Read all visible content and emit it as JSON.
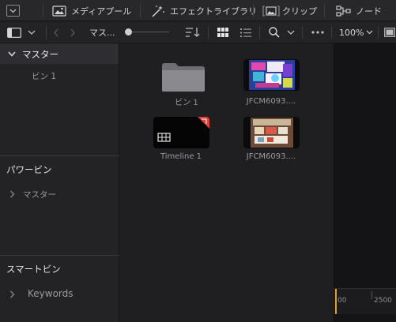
{
  "toolbar": {
    "media_pool": "メディアプール",
    "effects_library": "エフェクトライブラリ",
    "clips": "クリップ",
    "nodes": "ノード"
  },
  "subbar": {
    "breadcrumb": "マス...",
    "zoom": "100%"
  },
  "sidebar": {
    "master_header": "マスター",
    "master_bin": "ビン 1",
    "power_bins_header": "パワービン",
    "power_bins_master": "マスター",
    "smart_bins_header": "スマートビン",
    "smart_bins_keywords": "Keywords"
  },
  "clips": [
    {
      "label": "ビン 1",
      "kind": "folder"
    },
    {
      "label": "JFCM6093....",
      "kind": "video"
    },
    {
      "label": "Timeline 1",
      "kind": "timeline"
    },
    {
      "label": "JFCM6093....",
      "kind": "video"
    }
  ],
  "ruler": {
    "start": "00",
    "mark": "2500"
  },
  "colors": {
    "accent_red": "#e0413a",
    "playhead": "#e0a02a"
  }
}
